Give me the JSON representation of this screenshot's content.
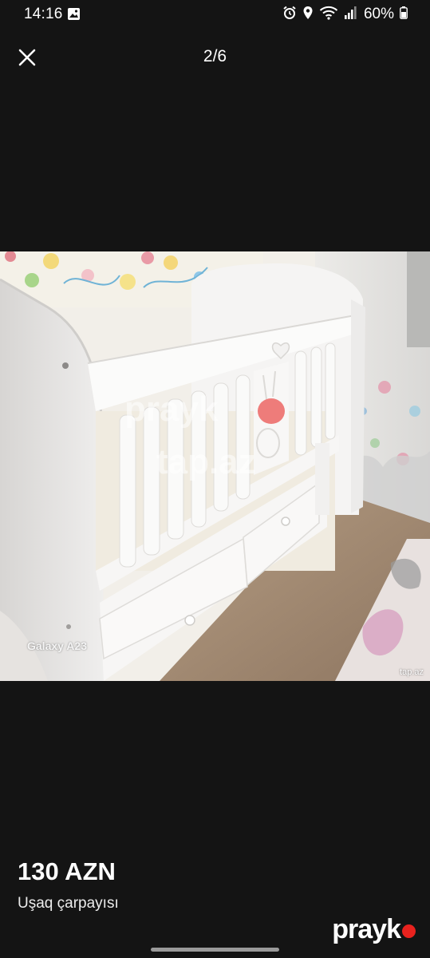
{
  "status_bar": {
    "time": "14:16",
    "battery": "60%",
    "icons": [
      "gallery-icon",
      "alarm-icon",
      "location-icon",
      "wifi-icon",
      "signal-icon",
      "battery-icon"
    ]
  },
  "viewer": {
    "counter": "2/6",
    "close_icon": "close-icon"
  },
  "photo": {
    "camera_label": "Galaxy A23",
    "source_label": "tap.az",
    "watermark_line1": "prayk",
    "watermark_line2": "tap.az"
  },
  "listing": {
    "price": "130 AZN",
    "title": "Uşaq çarpayısı"
  },
  "brand": {
    "name": "prayk",
    "accent": "#e8221e"
  }
}
